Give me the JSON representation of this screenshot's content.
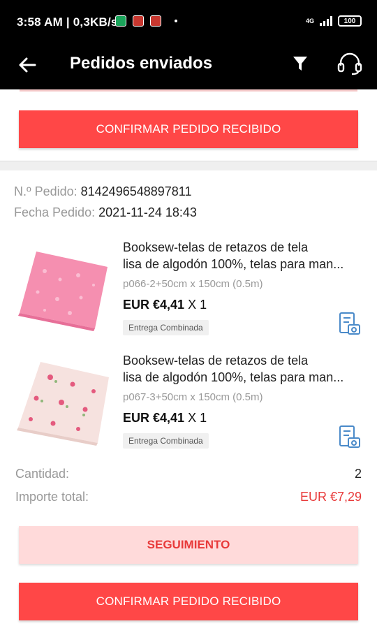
{
  "status_bar": {
    "time": "3:58 AM | 0,3KB/s",
    "network": "4G",
    "battery": "100"
  },
  "header": {
    "title": "Pedidos enviados"
  },
  "buttons": {
    "confirm_label": "CONFIRMAR PEDIDO RECIBIDO",
    "tracking_label": "SEGUIMIENTO"
  },
  "order": {
    "number_label": "N.º Pedido:",
    "number": "8142496548897811",
    "date_label": "Fecha Pedido:",
    "date": "2021-11-24 18:43",
    "items": [
      {
        "title_line1": "Booksew-telas de retazos de tela",
        "title_line2": "lisa de algodón 100%, telas para man...",
        "variant": "p066-2+50cm x 150cm (0.5m)",
        "price": "EUR €4,41",
        "quantity": "X 1",
        "badge": "Entrega Combinada",
        "image_color": "#f58fb0"
      },
      {
        "title_line1": "Booksew-telas de retazos de tela",
        "title_line2": "lisa de algodón 100%, telas para man...",
        "variant": "p067-3+50cm x 150cm (0.5m)",
        "price": "EUR €4,41",
        "quantity": "X 1",
        "badge": "Entrega Combinada",
        "image_color": "#f6e2df"
      }
    ],
    "quantity_label": "Cantidad:",
    "quantity_value": "2",
    "total_label": "Importe total:",
    "total_value": "EUR €7,29"
  },
  "colors": {
    "accent": "#ff4747",
    "tracking_bg": "#ffdada",
    "total_text": "#e83a3a",
    "icon_blue": "#4a8ac9"
  }
}
